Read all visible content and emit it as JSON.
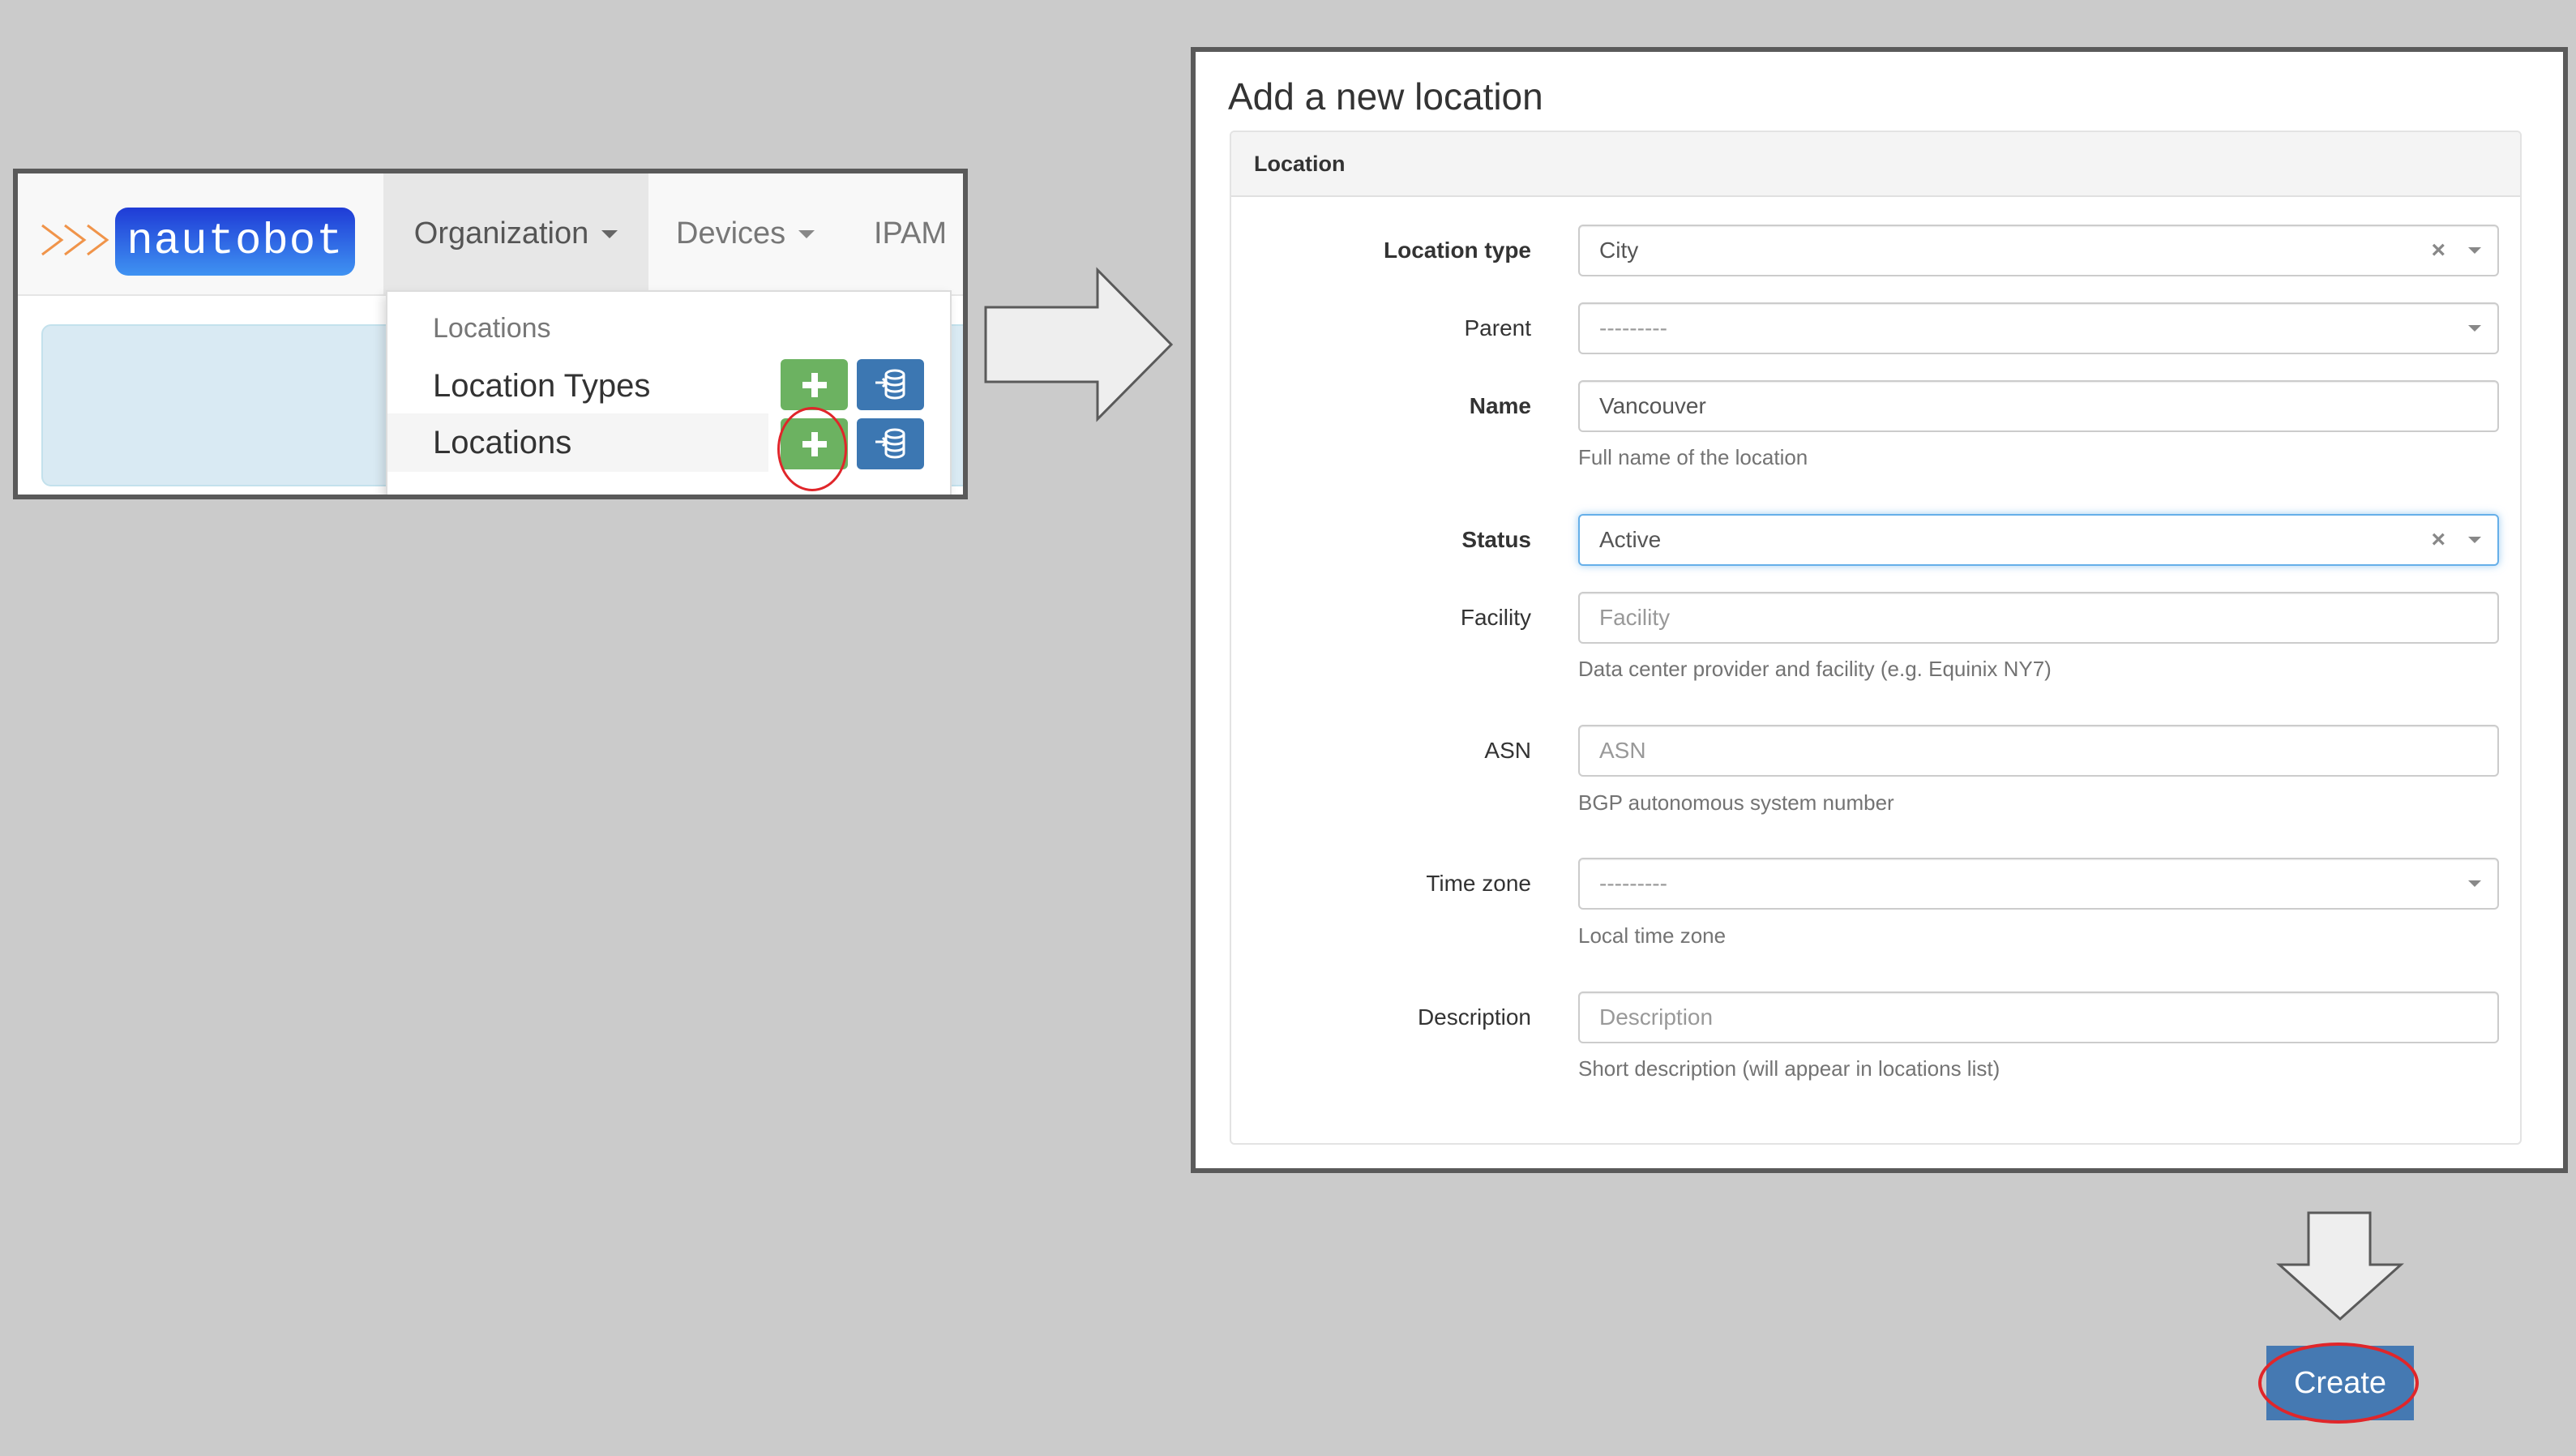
{
  "left_panel": {
    "logo_text": "nautobot",
    "nav_items": [
      {
        "label": "Organization",
        "has_caret": true,
        "active": true
      },
      {
        "label": "Devices",
        "has_caret": true,
        "active": false
      },
      {
        "label": "IPAM",
        "has_caret": false,
        "active": false
      }
    ],
    "dropdown": {
      "header": "Locations",
      "items": [
        {
          "label": "Location Types",
          "add_icon": "plus-icon",
          "import_icon": "database-import-icon",
          "highlighted": false
        },
        {
          "label": "Locations",
          "add_icon": "plus-icon",
          "import_icon": "database-import-icon",
          "highlighted": true
        }
      ]
    },
    "annotation": "red circle around Locations add button"
  },
  "form": {
    "title": "Add a new location",
    "panel_title": "Location",
    "fields": [
      {
        "label": "Location type",
        "required": true,
        "type": "select",
        "value": "City",
        "clearable": true,
        "help": ""
      },
      {
        "label": "Parent",
        "required": false,
        "type": "select",
        "value": "---------",
        "clearable": false,
        "help": ""
      },
      {
        "label": "Name",
        "required": true,
        "type": "text",
        "value": "Vancouver",
        "placeholder": "",
        "help": "Full name of the location"
      },
      {
        "label": "Status",
        "required": true,
        "type": "select",
        "value": "Active",
        "clearable": true,
        "focused": true,
        "help": ""
      },
      {
        "label": "Facility",
        "required": false,
        "type": "text",
        "value": "",
        "placeholder": "Facility",
        "help": "Data center provider and facility (e.g. Equinix NY7)"
      },
      {
        "label": "ASN",
        "required": false,
        "type": "text",
        "value": "",
        "placeholder": "ASN",
        "help": "BGP autonomous system number"
      },
      {
        "label": "Time zone",
        "required": false,
        "type": "select",
        "value": "---------",
        "clearable": false,
        "help": "Local time zone"
      },
      {
        "label": "Description",
        "required": false,
        "type": "text",
        "value": "",
        "placeholder": "Description",
        "help": "Short description (will appear in locations list)"
      }
    ],
    "clear_glyph": "×"
  },
  "create_button": {
    "label": "Create"
  },
  "colors": {
    "background": "#cbcbcb",
    "frame_border": "#5a5a5a",
    "add_green": "#6cb261",
    "import_blue": "#3c77b2",
    "create_blue": "#4579b2",
    "annotation_red": "#e0262a",
    "focus_blue": "#66afe9"
  },
  "icons": {
    "right_arrow": "arrow-right-icon",
    "down_arrow": "arrow-down-icon",
    "chevrons": "triple-chevron-icon"
  }
}
